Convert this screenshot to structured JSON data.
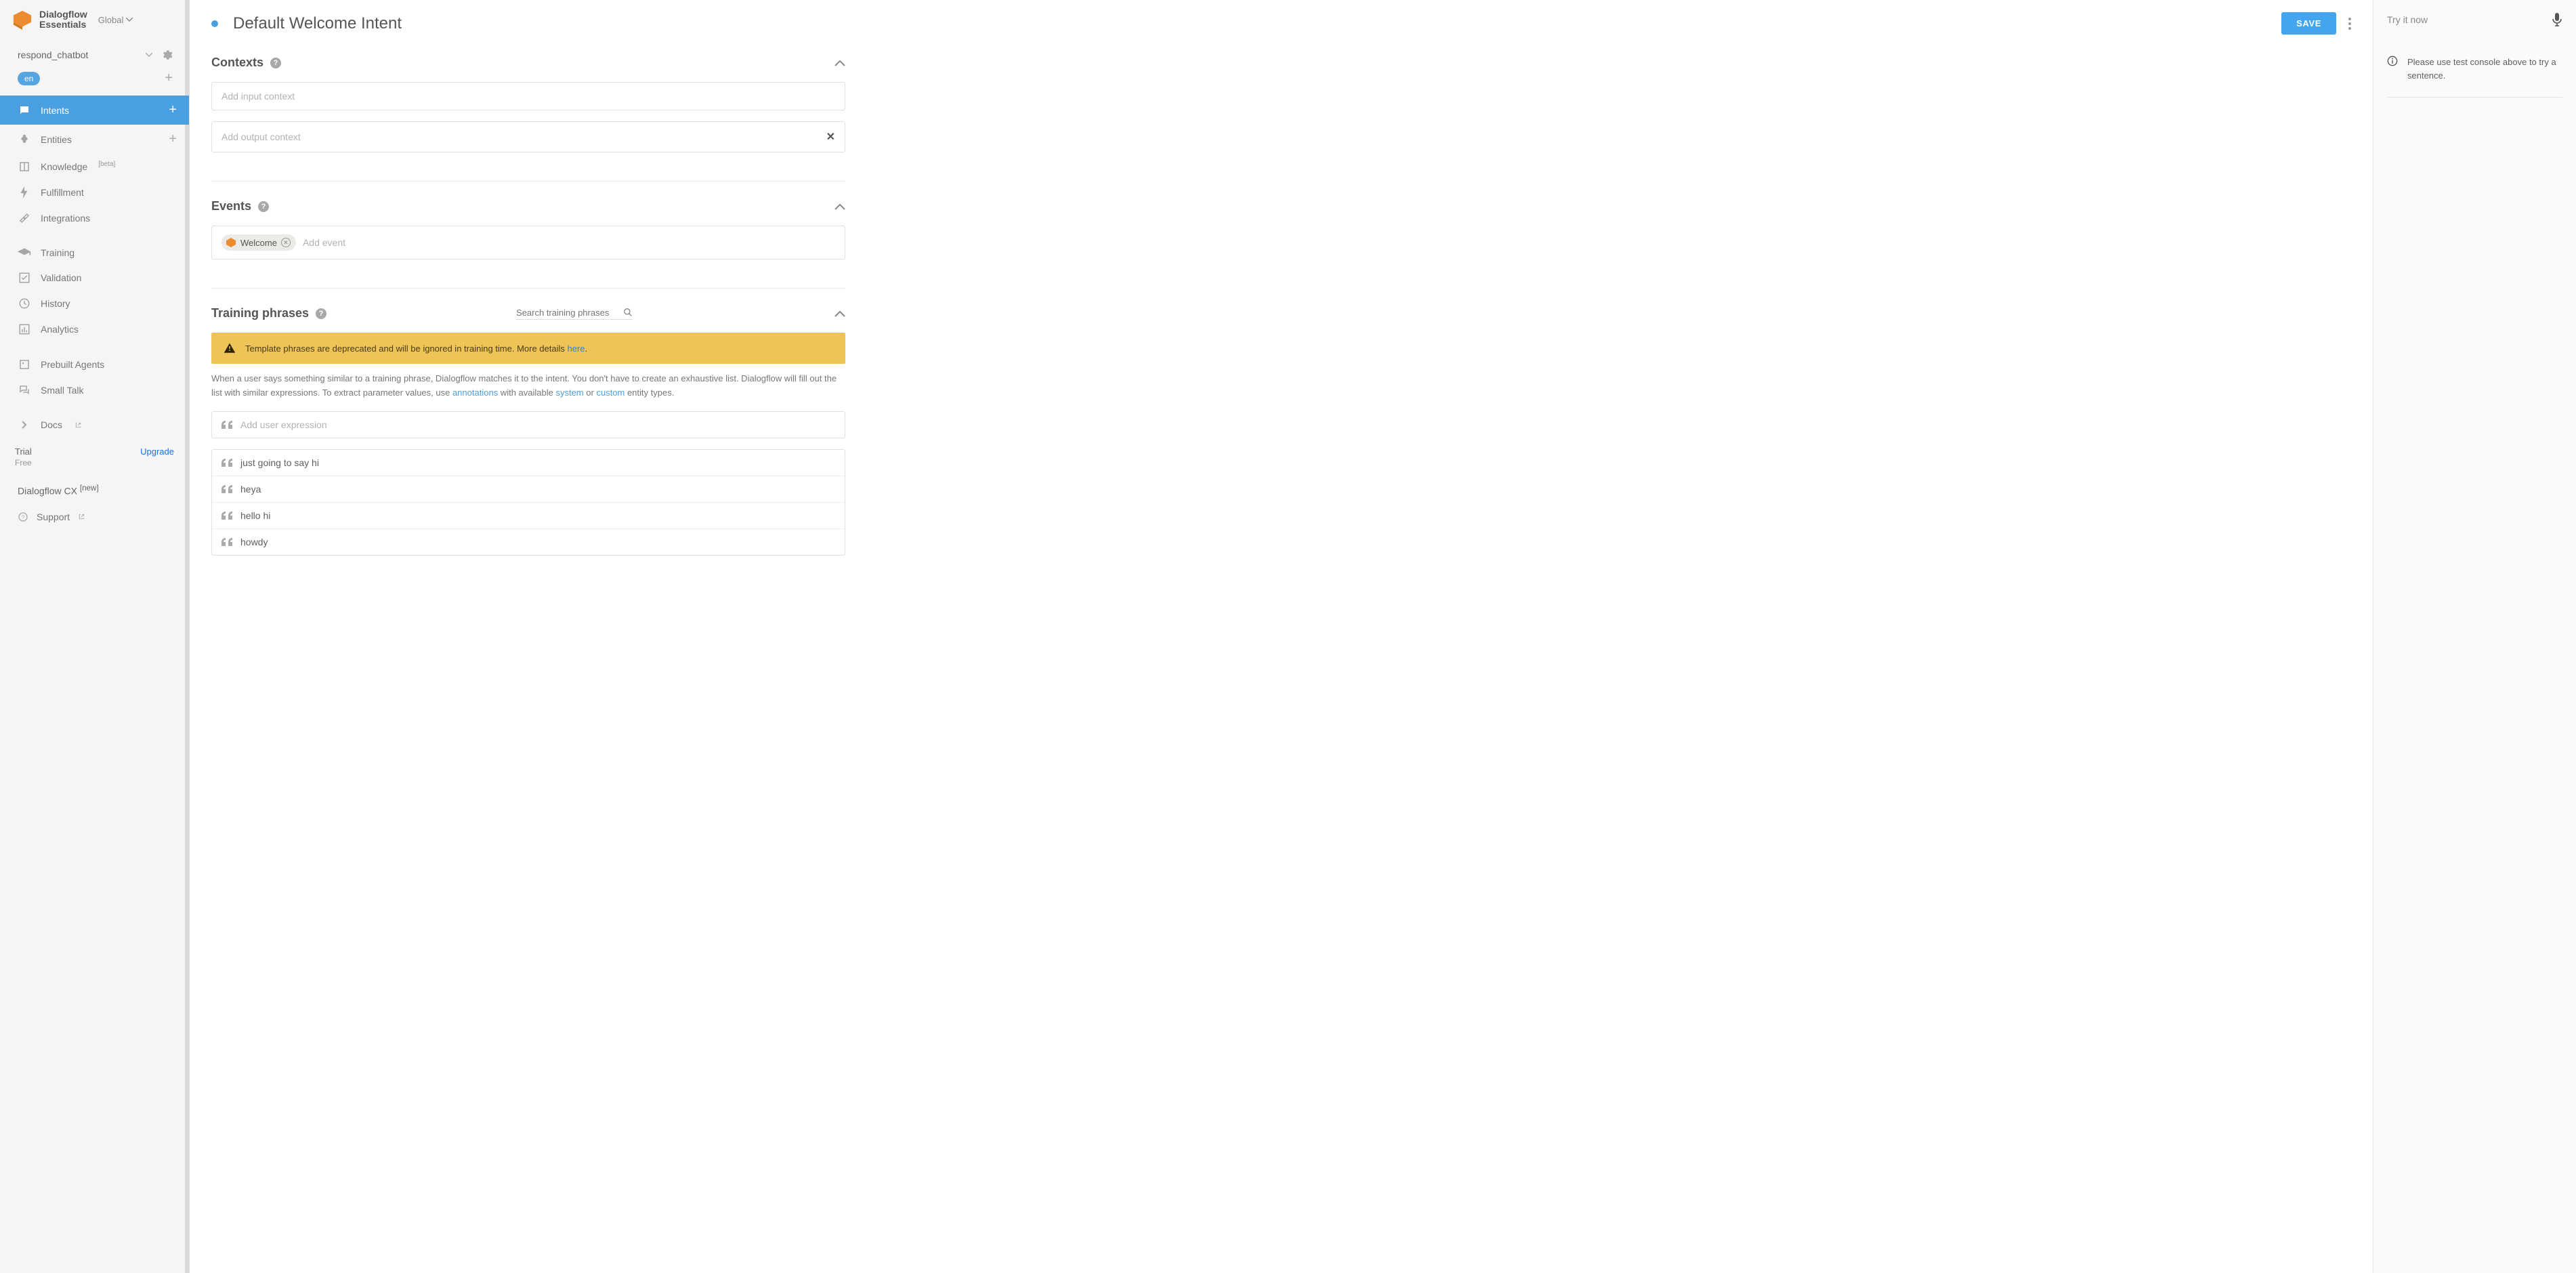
{
  "brand": {
    "line1": "Dialogflow",
    "line2": "Essentials",
    "global": "Global"
  },
  "agent": {
    "name": "respond_chatbot",
    "language": "en"
  },
  "sidebar": {
    "items": [
      {
        "label": "Intents",
        "active": true,
        "add": true
      },
      {
        "label": "Entities",
        "add_gray": true
      },
      {
        "label": "Knowledge",
        "sup": "[beta]"
      },
      {
        "label": "Fulfillment"
      },
      {
        "label": "Integrations"
      }
    ],
    "items2": [
      {
        "label": "Training"
      },
      {
        "label": "Validation"
      },
      {
        "label": "History"
      },
      {
        "label": "Analytics"
      }
    ],
    "items3": [
      {
        "label": "Prebuilt Agents"
      },
      {
        "label": "Small Talk"
      }
    ],
    "docs": "Docs",
    "trial": {
      "title": "Trial",
      "sub": "Free",
      "upgrade": "Upgrade"
    },
    "cx": {
      "label": "Dialogflow CX",
      "sup": "[new]"
    },
    "support": "Support"
  },
  "header": {
    "title": "Default Welcome Intent",
    "save": "SAVE"
  },
  "contexts": {
    "title": "Contexts",
    "input_placeholder": "Add input context",
    "output_placeholder": "Add output context"
  },
  "events": {
    "title": "Events",
    "chip": "Welcome",
    "add_placeholder": "Add event"
  },
  "training": {
    "title": "Training phrases",
    "search_placeholder": "Search training phrases",
    "warning_pre": "Template phrases are deprecated and will be ignored in training time. More details ",
    "warning_link": "here",
    "desc_1": "When a user says something similar to a training phrase, Dialogflow matches it to the intent. You don't have to create an exhaustive list. Dialogflow will fill out the list with similar expressions. To extract parameter values, use ",
    "desc_link1": "annotations",
    "desc_2": " with available ",
    "desc_link2": "system",
    "desc_3": " or ",
    "desc_link3": "custom",
    "desc_4": " entity types.",
    "add_placeholder": "Add user expression",
    "phrases": [
      "just going to say hi",
      "heya",
      "hello hi",
      "howdy"
    ]
  },
  "right": {
    "try": "Try it now",
    "msg": "Please use test console above to try a sentence."
  }
}
